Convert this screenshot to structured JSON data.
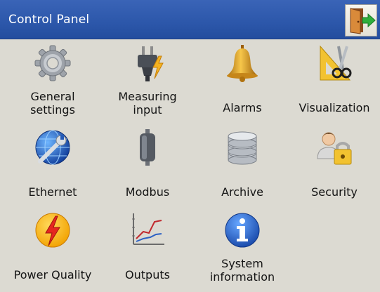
{
  "window": {
    "title": "Control Panel",
    "exit_icon": "exit-door-icon"
  },
  "tiles": [
    {
      "label": "General\nsettings",
      "icon": "gear-icon"
    },
    {
      "label": "Measuring\ninput",
      "icon": "plug-icon"
    },
    {
      "label": "Alarms",
      "icon": "bell-icon"
    },
    {
      "label": "Visualization",
      "icon": "scissors-ruler-icon"
    },
    {
      "label": "Ethernet",
      "icon": "globe-wrench-icon"
    },
    {
      "label": "Modbus",
      "icon": "device-cylinder-icon"
    },
    {
      "label": "Archive",
      "icon": "database-icon"
    },
    {
      "label": "Security",
      "icon": "user-lock-icon"
    },
    {
      "label": "Power Quality",
      "icon": "lightning-icon"
    },
    {
      "label": "Outputs",
      "icon": "line-graph-icon"
    },
    {
      "label": "System\ninformation",
      "icon": "info-icon"
    }
  ],
  "colors": {
    "titlebar": "#2c57aa",
    "background": "#dcdad2",
    "text": "#141414"
  }
}
